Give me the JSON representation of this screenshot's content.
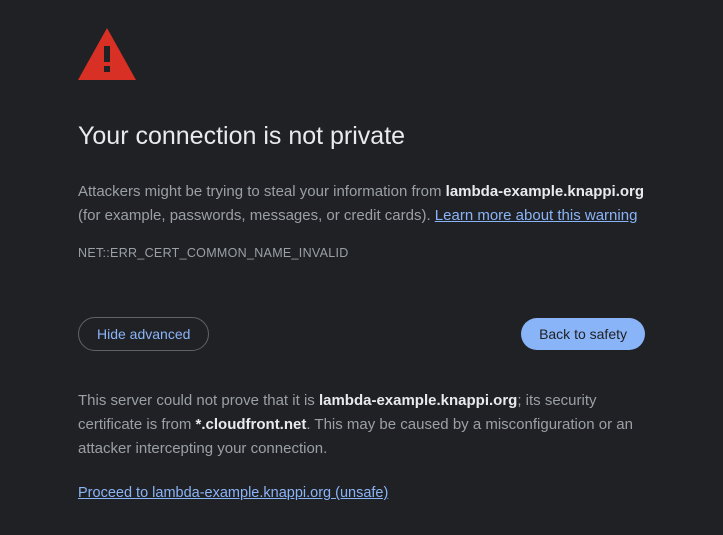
{
  "icon_name": "warning-triangle",
  "title": "Your connection is not private",
  "body": {
    "prefix": "Attackers might be trying to steal your information from ",
    "site": "lambda-example.knappi.org",
    "suffix": " (for example, passwords, messages, or credit cards). ",
    "learn_more": "Learn more about this warning"
  },
  "error_code": "NET::ERR_CERT_COMMON_NAME_INVALID",
  "buttons": {
    "advanced": "Hide advanced",
    "safety": "Back to safety"
  },
  "advanced": {
    "p1_prefix": "This server could not prove that it is ",
    "p1_site": "lambda-example.knappi.org",
    "p1_mid": "; its security certificate is from ",
    "p1_cert": "*.cloudfront.net",
    "p1_suffix": ". This may be caused by a misconfiguration or an attacker intercepting your connection."
  },
  "proceed_link": "Proceed to lambda-example.knappi.org (unsafe)"
}
